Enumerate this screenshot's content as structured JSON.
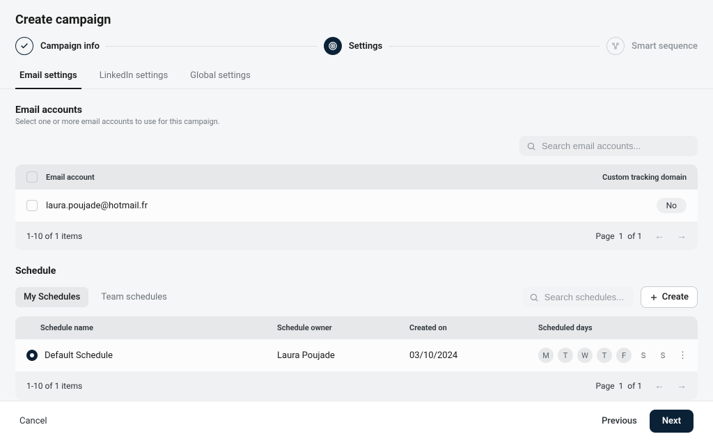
{
  "title": "Create campaign",
  "stepper": {
    "step1": "Campaign info",
    "step2": "Settings",
    "step3": "Smart sequence"
  },
  "tabs": {
    "email": "Email settings",
    "linkedin": "LinkedIn settings",
    "global": "Global settings"
  },
  "emailAccounts": {
    "title": "Email accounts",
    "subtitle": "Select one or more email accounts to use for this campaign.",
    "searchPlaceholder": "Search email accounts...",
    "columns": {
      "account": "Email account",
      "tracking": "Custom tracking domain"
    },
    "rows": [
      {
        "email": "laura.poujade@hotmail.fr",
        "tracking": "No"
      }
    ],
    "footer": {
      "range": "1-10 of 1 items",
      "pageLabel": "Page",
      "page": "1",
      "of": "of",
      "total": "1"
    }
  },
  "schedule": {
    "title": "Schedule",
    "segments": {
      "mine": "My Schedules",
      "team": "Team schedules"
    },
    "searchPlaceholder": "Search schedules...",
    "createLabel": "Create",
    "columns": {
      "name": "Schedule name",
      "owner": "Schedule owner",
      "created": "Created on",
      "days": "Scheduled days"
    },
    "rows": [
      {
        "name": "Default Schedule",
        "owner": "Laura Poujade",
        "created": "03/10/2024",
        "days": [
          "M",
          "T",
          "W",
          "T",
          "F",
          "S",
          "S"
        ],
        "activeDays": [
          true,
          true,
          true,
          true,
          true,
          false,
          false
        ]
      }
    ],
    "footer": {
      "range": "1-10 of 1 items",
      "pageLabel": "Page",
      "page": "1",
      "of": "of",
      "total": "1"
    }
  },
  "footer": {
    "cancel": "Cancel",
    "previous": "Previous",
    "next": "Next"
  }
}
